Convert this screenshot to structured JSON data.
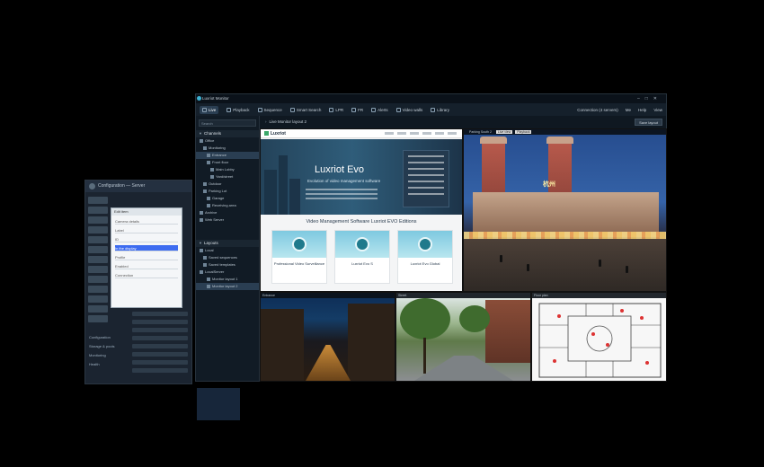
{
  "config_window": {
    "title": "Configuration — Server",
    "dialog": {
      "heading": "Edit item",
      "rows": [
        "Camera details",
        "Label",
        "ID",
        "Profile",
        "Enabled",
        "Connection"
      ],
      "selected_row": "In the display"
    },
    "left_links": [
      "Configuration",
      "Storage & pools",
      "Monitoring",
      "Health"
    ]
  },
  "main_window": {
    "title": "Luxriot Monitor",
    "tabs": [
      {
        "label": "Live",
        "active": true
      },
      {
        "label": "Playback"
      },
      {
        "label": "Sequence"
      },
      {
        "label": "Smart Search"
      },
      {
        "label": "LPR"
      },
      {
        "label": "FR"
      },
      {
        "label": "Alerts"
      },
      {
        "label": "Video walls"
      },
      {
        "label": "Library"
      }
    ],
    "right_items": [
      "Connection (4 servers)",
      "Me",
      "Help",
      "View"
    ],
    "sidebar": {
      "search_placeholder": "Search",
      "channels_header": "Channels",
      "channel_items": [
        "Office",
        "Monitoring",
        "Entrance",
        "Front floor",
        "Main Lobby",
        "Yard/street",
        "Outdoor",
        "Parking Lot",
        "Garage",
        "Receiving area",
        "Archive",
        "Web Server"
      ],
      "layouts_header": "Layouts",
      "layout_items": [
        "Local",
        "Saved sequences",
        "Saved templates",
        "LocalServer",
        "Monitor layout 1",
        "Monitor layout 2"
      ]
    },
    "viewer": {
      "label": "Live Monitor layout 2",
      "button": "Save layout"
    }
  },
  "web_tile": {
    "brand": "Luxriot",
    "hero_title": "Luxriot Evo",
    "hero_subtitle": "Evolution of video management software",
    "editions_title": "Video Management Software Luxriot EVO Editions",
    "products": [
      "Professional Video Surveillance",
      "Luxriot Evo S",
      "Luxriot Evo Global"
    ]
  },
  "station_tile": {
    "top_label": "Parking South 2",
    "buttons": [
      "Live view",
      "Playback"
    ],
    "sign": "杭州"
  },
  "bottom_tiles": {
    "city_label": "Entrance",
    "street_label": "Street",
    "plan_label": "Floor plan"
  },
  "colors": {
    "accent": "#3db3d4",
    "window_bg": "#0e1720",
    "active_tab": "#2a3e52"
  }
}
